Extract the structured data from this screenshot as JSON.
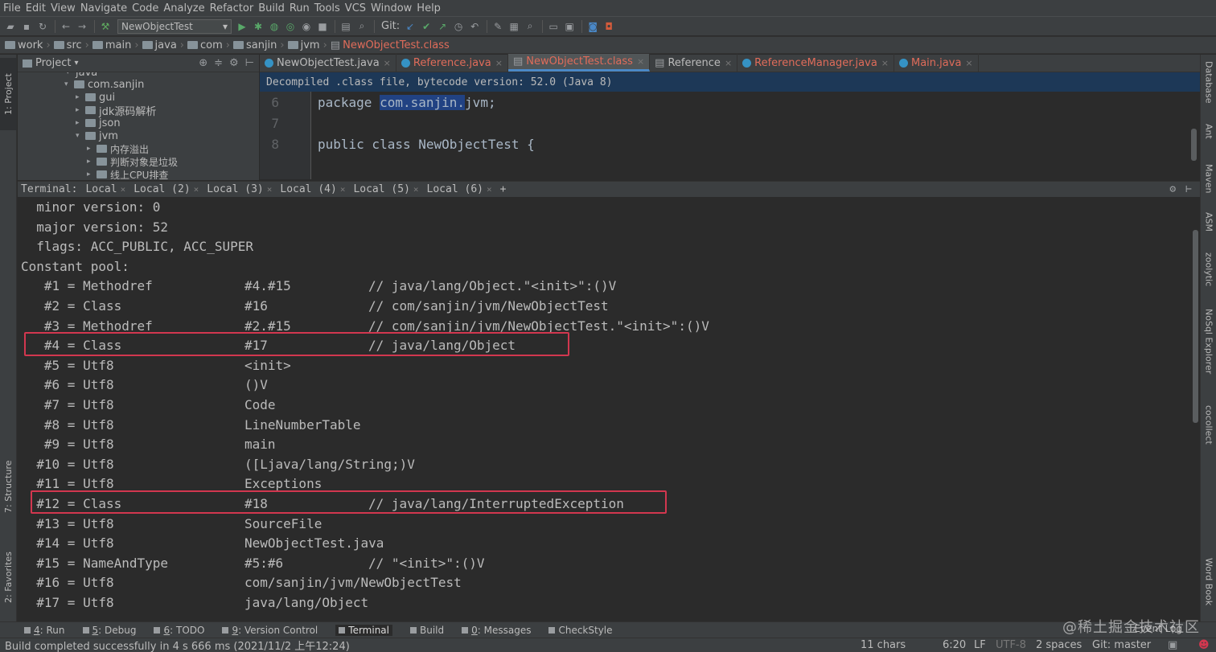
{
  "menu": [
    "File",
    "Edit",
    "View",
    "Navigate",
    "Code",
    "Analyze",
    "Refactor",
    "Build",
    "Run",
    "Tools",
    "VCS",
    "Window",
    "Help"
  ],
  "toolbar": {
    "run_config": "NewObjectTest",
    "git_label": "Git:"
  },
  "breadcrumbs": [
    "work",
    "src",
    "main",
    "java",
    "com",
    "sanjin",
    "jvm",
    "NewObjectTest.class"
  ],
  "left_stripe": {
    "project": "1: Project",
    "structure": "7: Structure",
    "favorites": "2: Favorites"
  },
  "right_stripe": [
    "Database",
    "Ant",
    "Maven",
    "ASM",
    "zoolytic",
    "NoSql Explorer",
    "cocollect",
    "Word Book"
  ],
  "project": {
    "title": "Project",
    "tree": [
      "java",
      "com.sanjin",
      "gui",
      "jdk源码解析",
      "json",
      "jvm",
      "内存溢出",
      "判断对象是垃圾",
      "线上CPU排查"
    ]
  },
  "editor": {
    "tabs": [
      "NewObjectTest.java",
      "Reference.java",
      "NewObjectTest.class",
      "Reference",
      "ReferenceManager.java",
      "Main.java"
    ],
    "banner": "Decompiled .class file, bytecode version: 52.0 (Java 8)",
    "line_numbers": [
      "6",
      "7",
      "8"
    ],
    "package_kw": "package",
    "package_hl": "com.sanjin.",
    "package_rest": "jvm;",
    "class_line": "public class NewObjectTest {"
  },
  "terminal": {
    "label": "Terminal:",
    "tabs": [
      "Local",
      "Local (2)",
      "Local (3)",
      "Local (4)",
      "Local (5)",
      "Local (6)"
    ],
    "add": "+",
    "header_lines": [
      "  minor version: 0",
      "  major version: 52",
      "  flags: ACC_PUBLIC, ACC_SUPER",
      "Constant pool:"
    ],
    "pool": [
      {
        "idx": "   #1 = Methodref",
        "ref": "#4.#15",
        "comment": "// java/lang/Object.\"<init>\":()V"
      },
      {
        "idx": "   #2 = Class",
        "ref": "#16",
        "comment": "// com/sanjin/jvm/NewObjectTest"
      },
      {
        "idx": "   #3 = Methodref",
        "ref": "#2.#15",
        "comment": "// com/sanjin/jvm/NewObjectTest.\"<init>\":()V"
      },
      {
        "idx": "   #4 = Class",
        "ref": "#17",
        "comment": "// java/lang/Object"
      },
      {
        "idx": "   #5 = Utf8",
        "ref": "<init>",
        "comment": ""
      },
      {
        "idx": "   #6 = Utf8",
        "ref": "()V",
        "comment": ""
      },
      {
        "idx": "   #7 = Utf8",
        "ref": "Code",
        "comment": ""
      },
      {
        "idx": "   #8 = Utf8",
        "ref": "LineNumberTable",
        "comment": ""
      },
      {
        "idx": "   #9 = Utf8",
        "ref": "main",
        "comment": ""
      },
      {
        "idx": "  #10 = Utf8",
        "ref": "([Ljava/lang/String;)V",
        "comment": ""
      },
      {
        "idx": "  #11 = Utf8",
        "ref": "Exceptions",
        "comment": ""
      },
      {
        "idx": "  #12 = Class",
        "ref": "#18",
        "comment": "// java/lang/InterruptedException"
      },
      {
        "idx": "  #13 = Utf8",
        "ref": "SourceFile",
        "comment": ""
      },
      {
        "idx": "  #14 = Utf8",
        "ref": "NewObjectTest.java",
        "comment": ""
      },
      {
        "idx": "  #15 = NameAndType",
        "ref": "#5:#6",
        "comment": "// \"<init>\":()V"
      },
      {
        "idx": "  #16 = Utf8",
        "ref": "com/sanjin/jvm/NewObjectTest",
        "comment": ""
      },
      {
        "idx": "  #17 = Utf8",
        "ref": "java/lang/Object",
        "comment": ""
      }
    ]
  },
  "tool_windows": [
    {
      "num": "4",
      "label": ": Run"
    },
    {
      "num": "5",
      "label": ": Debug"
    },
    {
      "num": "6",
      "label": ": TODO"
    },
    {
      "num": "9",
      "label": ": Version Control"
    },
    {
      "num": "",
      "label": "Terminal"
    },
    {
      "num": "",
      "label": "Build"
    },
    {
      "num": "0",
      "label": ": Messages"
    },
    {
      "num": "",
      "label": "CheckStyle"
    }
  ],
  "event_log": "Event Log",
  "status": {
    "message": "Build completed successfully in 4 s 666 ms (2021/11/2 上午12:24)",
    "chars": "11 chars",
    "position": "6:20",
    "line_sep": "LF",
    "encoding": "UTF-8",
    "indent": "2 spaces",
    "git": "Git: master"
  },
  "watermark": "@稀土掘金技术社区",
  "colors": {
    "highlight_box": "#d2374f",
    "selected_tab_underline": "#4a88c7",
    "banner_bg": "#1d3857"
  }
}
